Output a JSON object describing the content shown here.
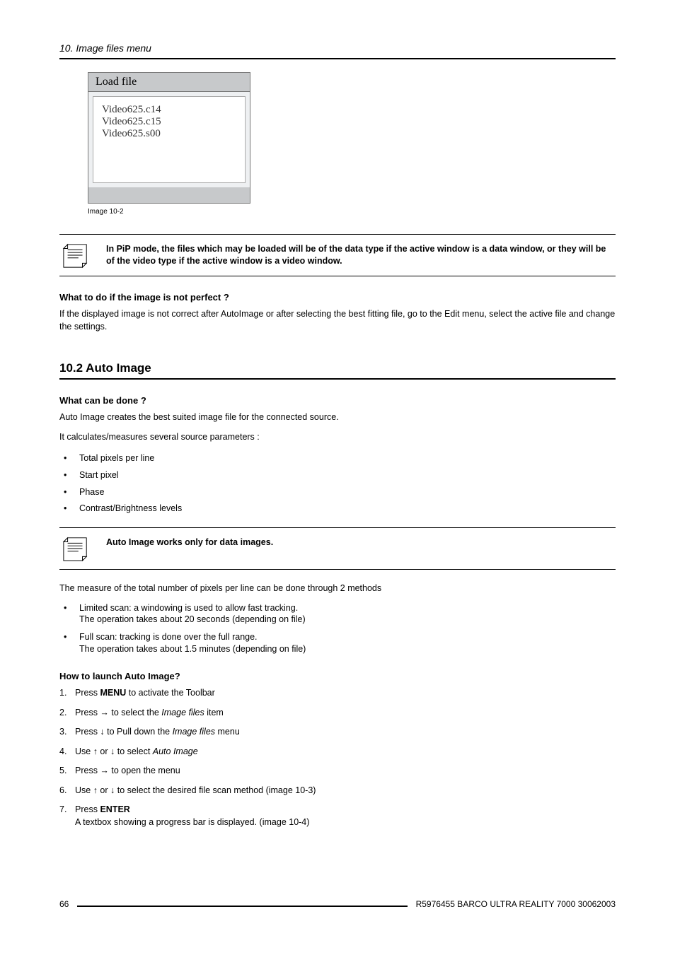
{
  "header": {
    "chapter": "10. Image files menu"
  },
  "loadfile": {
    "title": "Load file",
    "items": [
      "Video625.c14",
      "Video625.c15",
      "Video625.s00"
    ],
    "caption": "Image 10-2"
  },
  "note1": {
    "text": "In PiP mode, the files which may be loaded will be of the data type if the active window is a data window, or they will be of the video type if the active window is a video window."
  },
  "sub1": {
    "heading": "What to do if the image is not perfect ?",
    "body": "If the displayed image is not correct after AutoImage or after selecting the best fitting file, go to the Edit menu, select the active file and change the settings."
  },
  "section2": {
    "title": "10.2 Auto Image",
    "sub1_heading": "What can be done ?",
    "sub1_p1": "Auto Image creates the best suited image file for the connected source.",
    "sub1_p2": "It calculates/measures several source parameters :",
    "params": [
      "Total pixels per line",
      "Start pixel",
      "Phase",
      "Contrast/Brightness levels"
    ],
    "note2": "Auto Image works only for data images.",
    "p3": "The measure of the total number of pixels per line can be done through 2 methods",
    "methods": [
      {
        "line1": "Limited scan: a windowing is used to allow fast tracking.",
        "line2": "The operation takes about 20 seconds (depending on file)"
      },
      {
        "line1": "Full scan: tracking is done over the full range.",
        "line2": "The operation takes about 1.5 minutes (depending on file)"
      }
    ],
    "sub2_heading": "How to launch Auto Image?",
    "steps": {
      "s1_pre": "Press ",
      "s1_bold": "MENU",
      "s1_post": " to activate the Toolbar",
      "s2_pre": "Press → to select the ",
      "s2_italic": "Image files",
      "s2_post": " item",
      "s3_pre": "Press ↓ to Pull down the ",
      "s3_italic": "Image files",
      "s3_post": " menu",
      "s4_pre": "Use ↑ or ↓ to select ",
      "s4_italic": "Auto Image",
      "s5": "Press → to open the menu",
      "s6": "Use ↑ or ↓ to select the desired file scan method (image 10-3)",
      "s7_pre": "Press ",
      "s7_bold": "ENTER",
      "s7_line2": "A textbox showing a progress bar is displayed. (image 10-4)"
    }
  },
  "footer": {
    "page": "66",
    "text": "R5976455  BARCO ULTRA REALITY 7000  30062003"
  }
}
